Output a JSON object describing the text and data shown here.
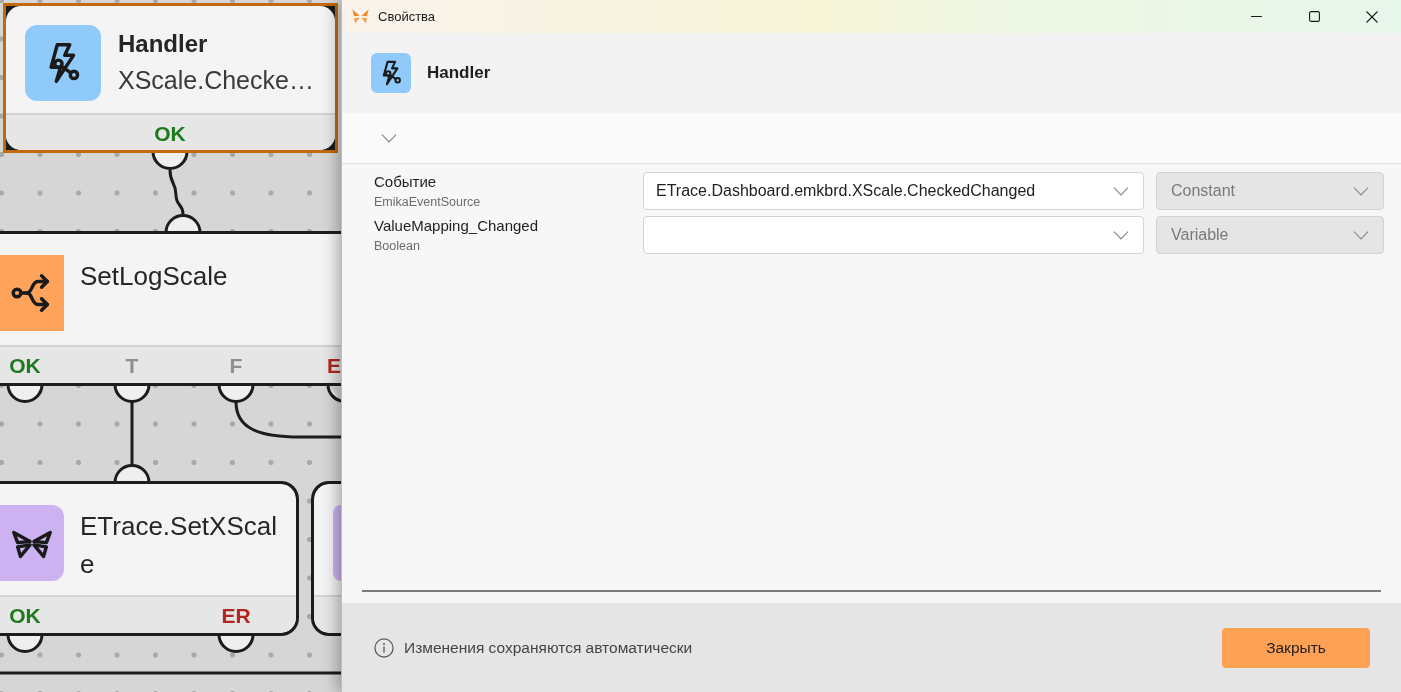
{
  "canvas": {
    "nodes": [
      {
        "kind": "handler",
        "title": "Handler",
        "subtitle": "XScale.Checke…",
        "selected": true,
        "outputs": [
          {
            "label": "OK",
            "kind": "ok"
          }
        ]
      },
      {
        "kind": "branch",
        "title": "SetLogScale",
        "selected": false,
        "outputs": [
          {
            "label": "OK",
            "kind": "ok"
          },
          {
            "label": "T",
            "kind": "neutral"
          },
          {
            "label": "F",
            "kind": "neutral"
          },
          {
            "label": "E",
            "kind": "error"
          }
        ]
      },
      {
        "kind": "action",
        "title": "ETrace.SetXScale",
        "selected": false,
        "outputs": [
          {
            "label": "OK",
            "kind": "ok"
          },
          {
            "label": "ER",
            "kind": "error"
          }
        ]
      },
      {
        "kind": "action",
        "selected": false
      }
    ]
  },
  "dialog": {
    "title": "Свойства",
    "header": {
      "kind": "handler",
      "title": "Handler"
    },
    "details": {
      "expanded": false
    },
    "properties": [
      {
        "name": "Событие",
        "type": "EmikaEventSource",
        "value": "ETrace.Dashboard.emkbrd.XScale.CheckedChanged",
        "mode": "Constant"
      },
      {
        "name": "ValueMapping_Changed",
        "type": "Boolean",
        "mode": "Variable"
      }
    ],
    "footer": {
      "note": "Изменения сохраняются автоматически",
      "button": "Закрыть"
    }
  }
}
